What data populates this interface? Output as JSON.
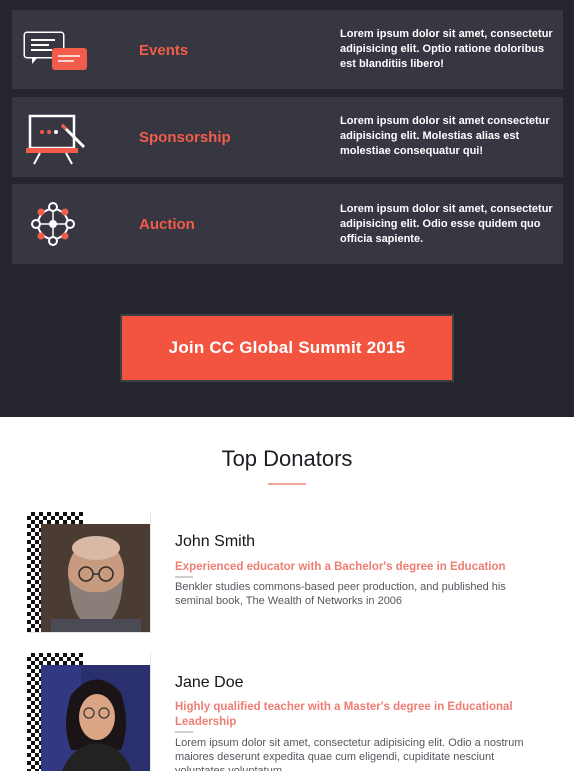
{
  "features": [
    {
      "icon": "chat-bubbles-icon",
      "title": "Events",
      "description": "Lorem ipsum dolor sit amet, consectetur adipisicing elit. Optio ratione doloribus est blanditiis libero!"
    },
    {
      "icon": "presentation-board-icon",
      "title": "Sponsorship",
      "description": "Lorem ipsum dolor sit amet consectetur adipisicing elit. Molestias alias est molestiae consequatur qui!"
    },
    {
      "icon": "network-icon",
      "title": "Auction",
      "description": "Lorem ipsum dolor sit amet, consectetur adipisicing elit. Odio esse quidem quo officia sapiente."
    }
  ],
  "cta": {
    "label": "Join CC Global Summit 2015"
  },
  "donators": {
    "heading": "Top Donators",
    "items": [
      {
        "name": "John Smith",
        "role": "Experienced educator with a Bachelor's degree in Education",
        "bio": "Benkler studies commons-based peer production, and published his seminal book, The Wealth of Networks in 2006"
      },
      {
        "name": "Jane Doe",
        "role": "Highly qualified teacher with a Master's degree in Educational Leadership",
        "bio": "Lorem ipsum dolor sit amet, consectetur adipisicing elit. Odio a nostrum maiores deserunt expedita quae cum eligendi, cupiditate nesciunt voluptates voluptatum"
      }
    ]
  },
  "colors": {
    "accent": "#f25440",
    "dark_bg": "#24252d",
    "panel_bg": "#363740",
    "role_text": "#ee7d73"
  }
}
